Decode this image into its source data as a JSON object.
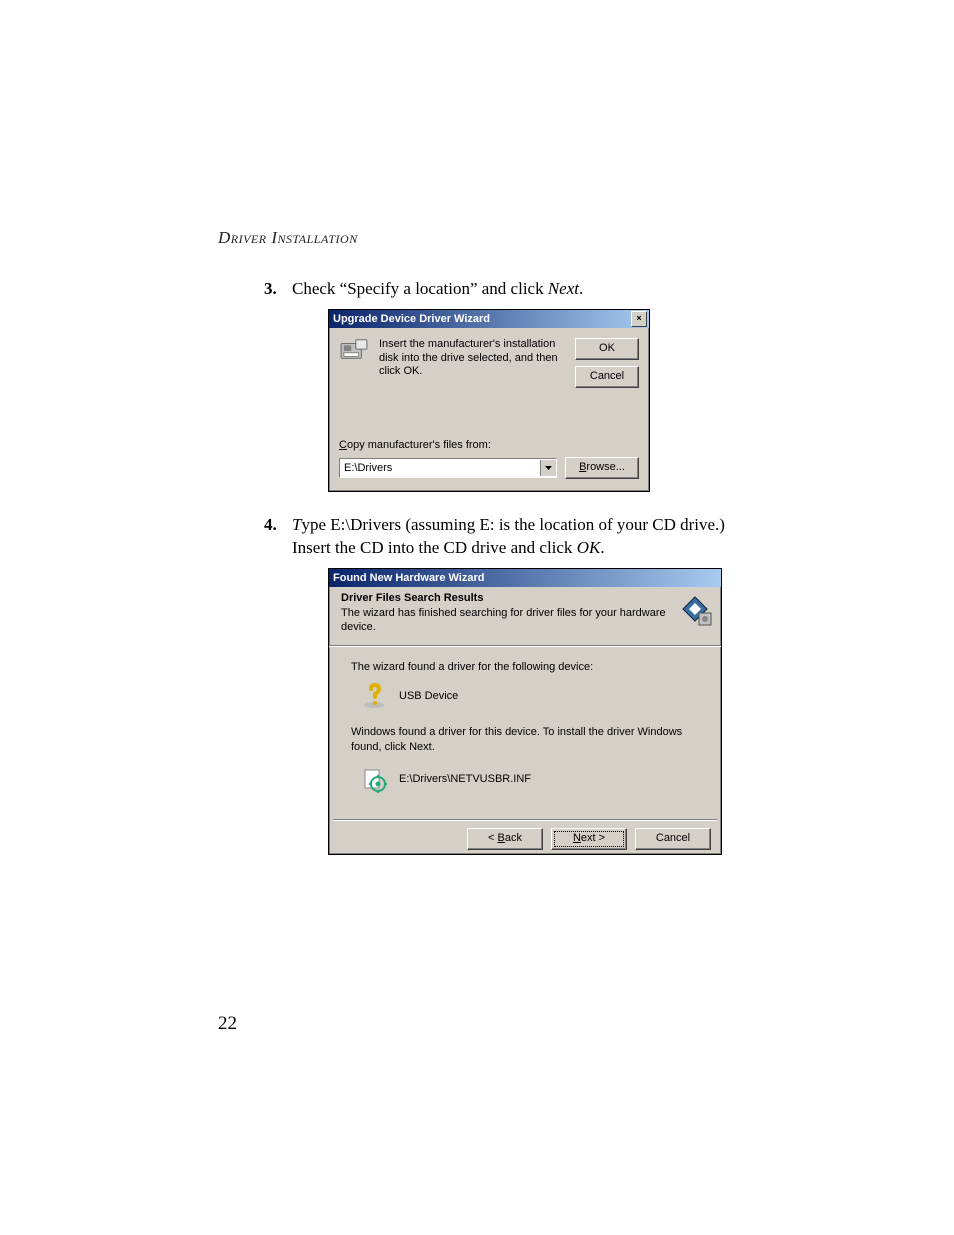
{
  "header_title": "Driver Installation",
  "page_number": "22",
  "steps": {
    "s3": {
      "num": "3.",
      "text_before": "Check “Specify a location” and click ",
      "text_italic": "Next",
      "text_after": "."
    },
    "s4": {
      "num": "4.",
      "t_lead": "T",
      "text_rest": "ype E:\\Drivers (assuming E: is the location of your CD drive.) Insert the CD into the CD drive and click ",
      "text_italic": "OK",
      "text_after": "."
    }
  },
  "dialog1": {
    "title": "Upgrade Device Driver Wizard",
    "message": "Insert the manufacturer's installation disk into the drive selected, and then click OK.",
    "ok": "OK",
    "cancel": "Cancel",
    "copy_label_pre": "C",
    "copy_label_post": "opy manufacturer's files from:",
    "path_value": "E:\\Drivers",
    "browse_pre": "B",
    "browse_post": "rowse..."
  },
  "dialog2": {
    "title": "Found New Hardware Wizard",
    "heading": "Driver Files Search Results",
    "subheading": "The wizard has finished searching for driver files for your hardware device.",
    "found_line": "The wizard found a driver for the following device:",
    "device_name": "USB Device",
    "install_line": "Windows found a driver for this device. To install the driver Windows found, click Next.",
    "inf_path": "E:\\Drivers\\NETVUSBR.INF",
    "back_pre": "< ",
    "back_u": "B",
    "back_post": "ack",
    "next_u": "N",
    "next_post": "ext >",
    "cancel": "Cancel"
  }
}
